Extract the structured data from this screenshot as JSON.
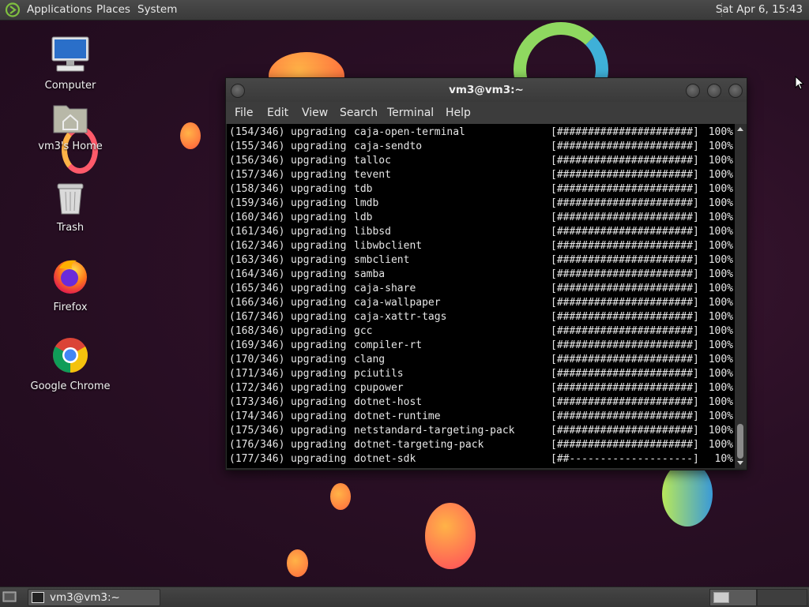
{
  "top_panel": {
    "menus": [
      "Applications",
      "Places",
      "System"
    ],
    "clock": "Sat Apr  6, 15:43"
  },
  "desktop_icons": [
    {
      "label": "Computer",
      "icon": "computer-icon"
    },
    {
      "label": "vm3's Home",
      "icon": "home-folder-icon"
    },
    {
      "label": "Trash",
      "icon": "trash-icon"
    },
    {
      "label": "Firefox",
      "icon": "firefox-icon"
    },
    {
      "label": "Google Chrome",
      "icon": "chrome-icon"
    }
  ],
  "terminal": {
    "title": "vm3@vm3:~",
    "menu": [
      "File",
      "Edit",
      "View",
      "Search",
      "Terminal",
      "Help"
    ],
    "lines": [
      {
        "idx": "(154/346)",
        "action": "upgrading",
        "pkg": "caja-open-terminal",
        "bar": "[######################]",
        "pct": "100%"
      },
      {
        "idx": "(155/346)",
        "action": "upgrading",
        "pkg": "caja-sendto",
        "bar": "[######################]",
        "pct": "100%"
      },
      {
        "idx": "(156/346)",
        "action": "upgrading",
        "pkg": "talloc",
        "bar": "[######################]",
        "pct": "100%"
      },
      {
        "idx": "(157/346)",
        "action": "upgrading",
        "pkg": "tevent",
        "bar": "[######################]",
        "pct": "100%"
      },
      {
        "idx": "(158/346)",
        "action": "upgrading",
        "pkg": "tdb",
        "bar": "[######################]",
        "pct": "100%"
      },
      {
        "idx": "(159/346)",
        "action": "upgrading",
        "pkg": "lmdb",
        "bar": "[######################]",
        "pct": "100%"
      },
      {
        "idx": "(160/346)",
        "action": "upgrading",
        "pkg": "ldb",
        "bar": "[######################]",
        "pct": "100%"
      },
      {
        "idx": "(161/346)",
        "action": "upgrading",
        "pkg": "libbsd",
        "bar": "[######################]",
        "pct": "100%"
      },
      {
        "idx": "(162/346)",
        "action": "upgrading",
        "pkg": "libwbclient",
        "bar": "[######################]",
        "pct": "100%"
      },
      {
        "idx": "(163/346)",
        "action": "upgrading",
        "pkg": "smbclient",
        "bar": "[######################]",
        "pct": "100%"
      },
      {
        "idx": "(164/346)",
        "action": "upgrading",
        "pkg": "samba",
        "bar": "[######################]",
        "pct": "100%"
      },
      {
        "idx": "(165/346)",
        "action": "upgrading",
        "pkg": "caja-share",
        "bar": "[######################]",
        "pct": "100%"
      },
      {
        "idx": "(166/346)",
        "action": "upgrading",
        "pkg": "caja-wallpaper",
        "bar": "[######################]",
        "pct": "100%"
      },
      {
        "idx": "(167/346)",
        "action": "upgrading",
        "pkg": "caja-xattr-tags",
        "bar": "[######################]",
        "pct": "100%"
      },
      {
        "idx": "(168/346)",
        "action": "upgrading",
        "pkg": "gcc",
        "bar": "[######################]",
        "pct": "100%"
      },
      {
        "idx": "(169/346)",
        "action": "upgrading",
        "pkg": "compiler-rt",
        "bar": "[######################]",
        "pct": "100%"
      },
      {
        "idx": "(170/346)",
        "action": "upgrading",
        "pkg": "clang",
        "bar": "[######################]",
        "pct": "100%"
      },
      {
        "idx": "(171/346)",
        "action": "upgrading",
        "pkg": "pciutils",
        "bar": "[######################]",
        "pct": "100%"
      },
      {
        "idx": "(172/346)",
        "action": "upgrading",
        "pkg": "cpupower",
        "bar": "[######################]",
        "pct": "100%"
      },
      {
        "idx": "(173/346)",
        "action": "upgrading",
        "pkg": "dotnet-host",
        "bar": "[######################]",
        "pct": "100%"
      },
      {
        "idx": "(174/346)",
        "action": "upgrading",
        "pkg": "dotnet-runtime",
        "bar": "[######################]",
        "pct": "100%"
      },
      {
        "idx": "(175/346)",
        "action": "upgrading",
        "pkg": "netstandard-targeting-pack",
        "bar": "[######################]",
        "pct": "100%"
      },
      {
        "idx": "(176/346)",
        "action": "upgrading",
        "pkg": "dotnet-targeting-pack",
        "bar": "[######################]",
        "pct": "100%"
      },
      {
        "idx": "(177/346)",
        "action": "upgrading",
        "pkg": "dotnet-sdk",
        "bar": "[##--------------------]",
        "pct": "10%"
      }
    ],
    "scroll_position": 0.9
  },
  "taskbar": {
    "task_label": "vm3@vm3:~",
    "workspaces": 2,
    "active_workspace": 1
  },
  "colors": {
    "desktop_bg": "#2a0f25",
    "panel_bg": "#3a3a3a",
    "terminal_bg": "#000000",
    "terminal_fg": "#e6e6e6"
  }
}
